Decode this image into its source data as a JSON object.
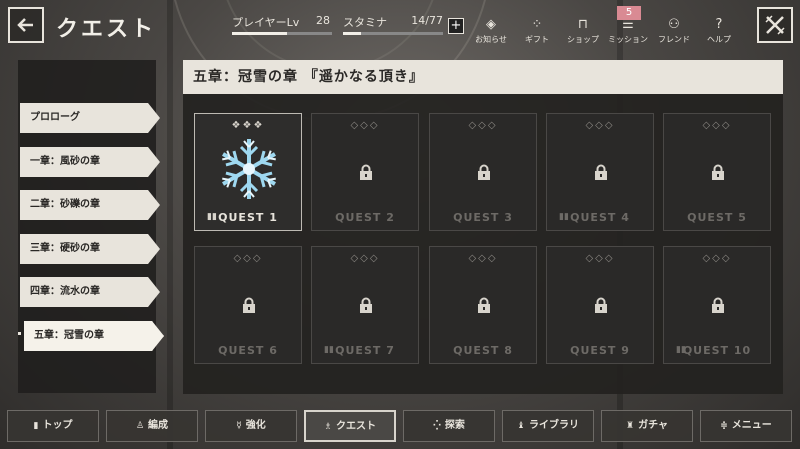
{
  "header": {
    "title": "クエスト",
    "player_label": "プレイヤーLv",
    "player_level": "28",
    "player_progress": 0.55,
    "stamina_label": "スタミナ",
    "stamina_value": "14/77",
    "stamina_progress": 0.18,
    "icons": [
      {
        "label": "お知らせ",
        "icon": "notice-icon"
      },
      {
        "label": "ギフト",
        "icon": "gift-icon"
      },
      {
        "label": "ショップ",
        "icon": "shop-icon"
      },
      {
        "label": "ミッション",
        "icon": "mission-icon"
      },
      {
        "label": "フレンド",
        "icon": "friend-icon"
      },
      {
        "label": "ヘルプ",
        "icon": "help-icon"
      }
    ],
    "mission_badge": "5"
  },
  "sidebar": {
    "chapters": [
      "プロローグ",
      "一章：風砂の章",
      "二章：砂礫の章",
      "三章：硬砂の章",
      "四章：流水の章",
      "五章：冠雪の章"
    ],
    "active_index": 5
  },
  "main": {
    "banner": "五章：冠雪の章 『遥かなる頂き』",
    "quests": [
      {
        "label": "QUEST 1",
        "unlocked": true,
        "story": true
      },
      {
        "label": "QUEST 2",
        "unlocked": false,
        "story": false
      },
      {
        "label": "QUEST 3",
        "unlocked": false,
        "story": false
      },
      {
        "label": "QUEST 4",
        "unlocked": false,
        "story": true
      },
      {
        "label": "QUEST 5",
        "unlocked": false,
        "story": false
      },
      {
        "label": "QUEST 6",
        "unlocked": false,
        "story": false
      },
      {
        "label": "QUEST 7",
        "unlocked": false,
        "story": true
      },
      {
        "label": "QUEST 8",
        "unlocked": false,
        "story": false
      },
      {
        "label": "QUEST 9",
        "unlocked": false,
        "story": false
      },
      {
        "label": "QUEST 10",
        "unlocked": false,
        "story": true
      }
    ]
  },
  "bottom_nav": [
    {
      "label": "トップ",
      "icon": "top-icon"
    },
    {
      "label": "編成",
      "icon": "formation-icon"
    },
    {
      "label": "強化",
      "icon": "enhance-icon"
    },
    {
      "label": "クエスト",
      "icon": "quest-icon",
      "active": true
    },
    {
      "label": "探索",
      "icon": "explore-icon"
    },
    {
      "label": "ライブラリ",
      "icon": "library-icon"
    },
    {
      "label": "ガチャ",
      "icon": "gacha-icon"
    },
    {
      "label": "メニュー",
      "icon": "menu-icon"
    }
  ],
  "colors": {
    "panel": "#e8e4dc",
    "badge": "#d98a93",
    "snowflake": "#9ed8f0"
  }
}
